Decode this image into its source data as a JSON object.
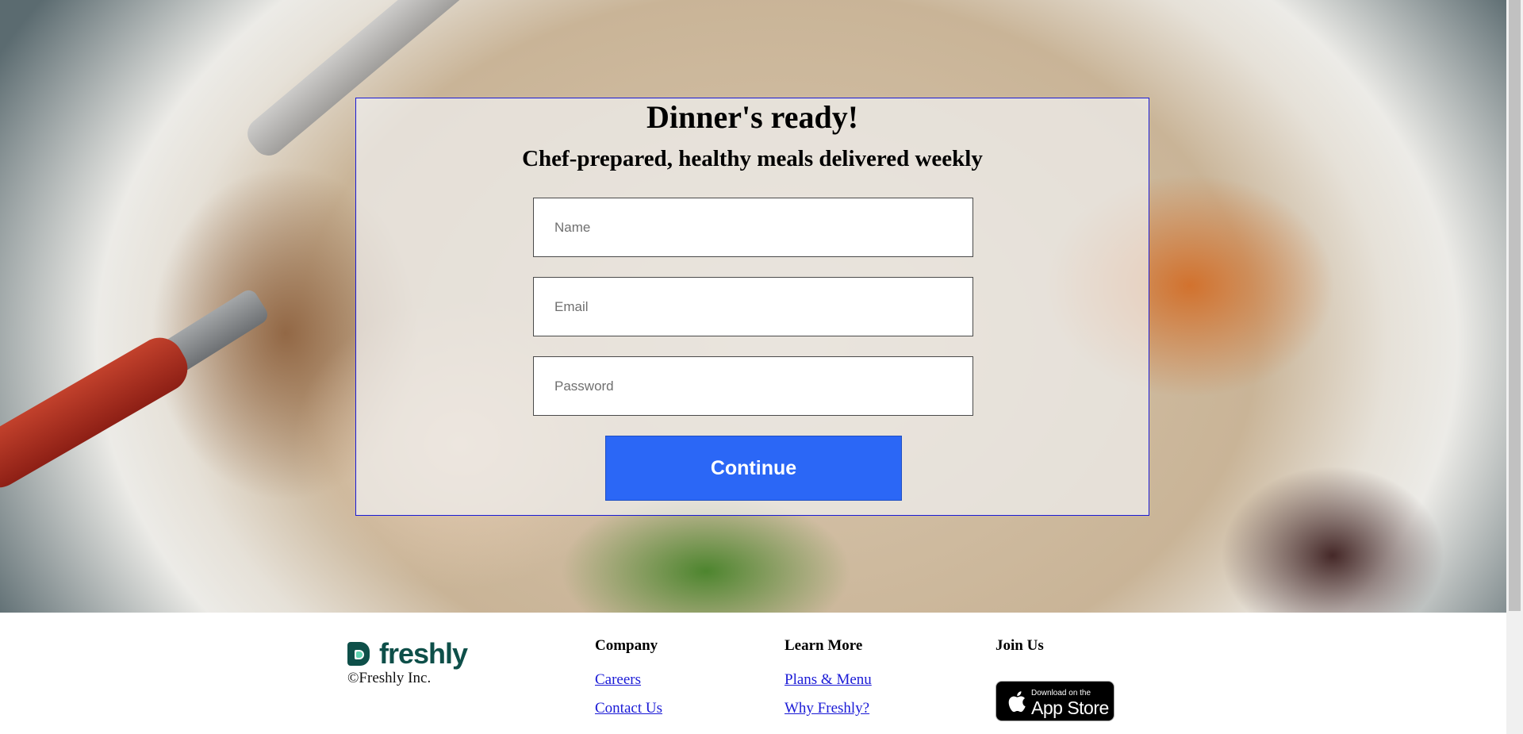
{
  "hero": {
    "title": "Dinner's ready!",
    "subtitle": "Chef-prepared, healthy meals delivered weekly",
    "fields": {
      "name_placeholder": "Name",
      "email_placeholder": "Email",
      "password_placeholder": "Password"
    },
    "continue_label": "Continue"
  },
  "footer": {
    "brand": "freshly",
    "copyright": "©Freshly Inc.",
    "columns": [
      {
        "heading": "Company",
        "links": [
          "Careers",
          "Contact Us"
        ]
      },
      {
        "heading": "Learn More",
        "links": [
          "Plans & Menu",
          "Why Freshly?"
        ]
      },
      {
        "heading": "Join Us"
      }
    ],
    "app_store": {
      "small": "Download on the",
      "big": "App Store"
    }
  },
  "colors": {
    "accent": "#2b67f6",
    "brand": "#0e4f49",
    "link": "#1a1ad6"
  }
}
